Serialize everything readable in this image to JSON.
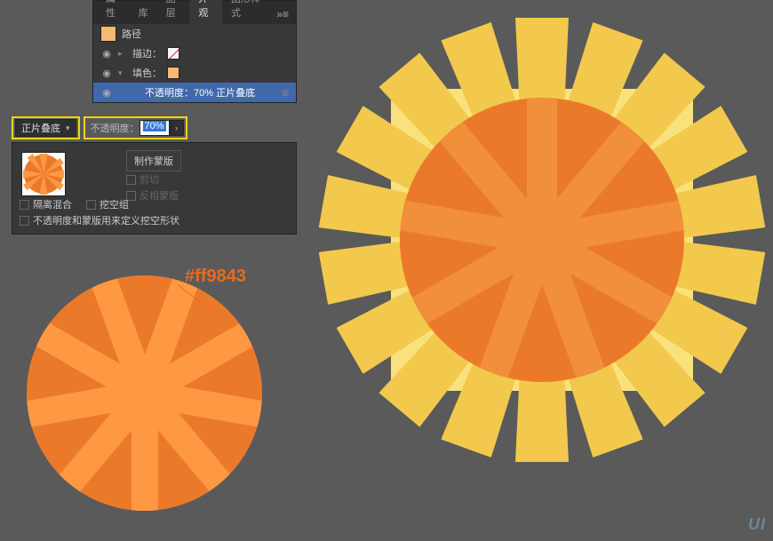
{
  "tabs": {
    "t1": "属性",
    "t2": "库",
    "t3": "图层",
    "t4": "外观",
    "t5": "图形样式"
  },
  "appearance": {
    "object_type": "路径",
    "stroke_label": "描边：",
    "fill_label": "填色：",
    "opacity_line": "不透明度：70% 正片叠底"
  },
  "blend": {
    "mode_label": "正片叠底",
    "opacity_label": "不透明度：",
    "opacity_value": "70%"
  },
  "mask": {
    "make_mask": "制作蒙版",
    "clip": "剪切",
    "invert": "反相蒙版",
    "isolate": "隔离混合",
    "knockout": "挖空组",
    "longopt": "不透明度和蒙版用来定义挖空形状"
  },
  "hex": "#ff9843",
  "chart_data": {
    "type": "illustration",
    "colors": {
      "ray_dark": "#ea7a2a",
      "ray_light": "#ff9843",
      "sun_ray": "#f2c94c",
      "sun_bg": "#f9e27e"
    },
    "blend_mode": "正片叠底",
    "opacity_pct": 70
  },
  "watermark": "UI"
}
